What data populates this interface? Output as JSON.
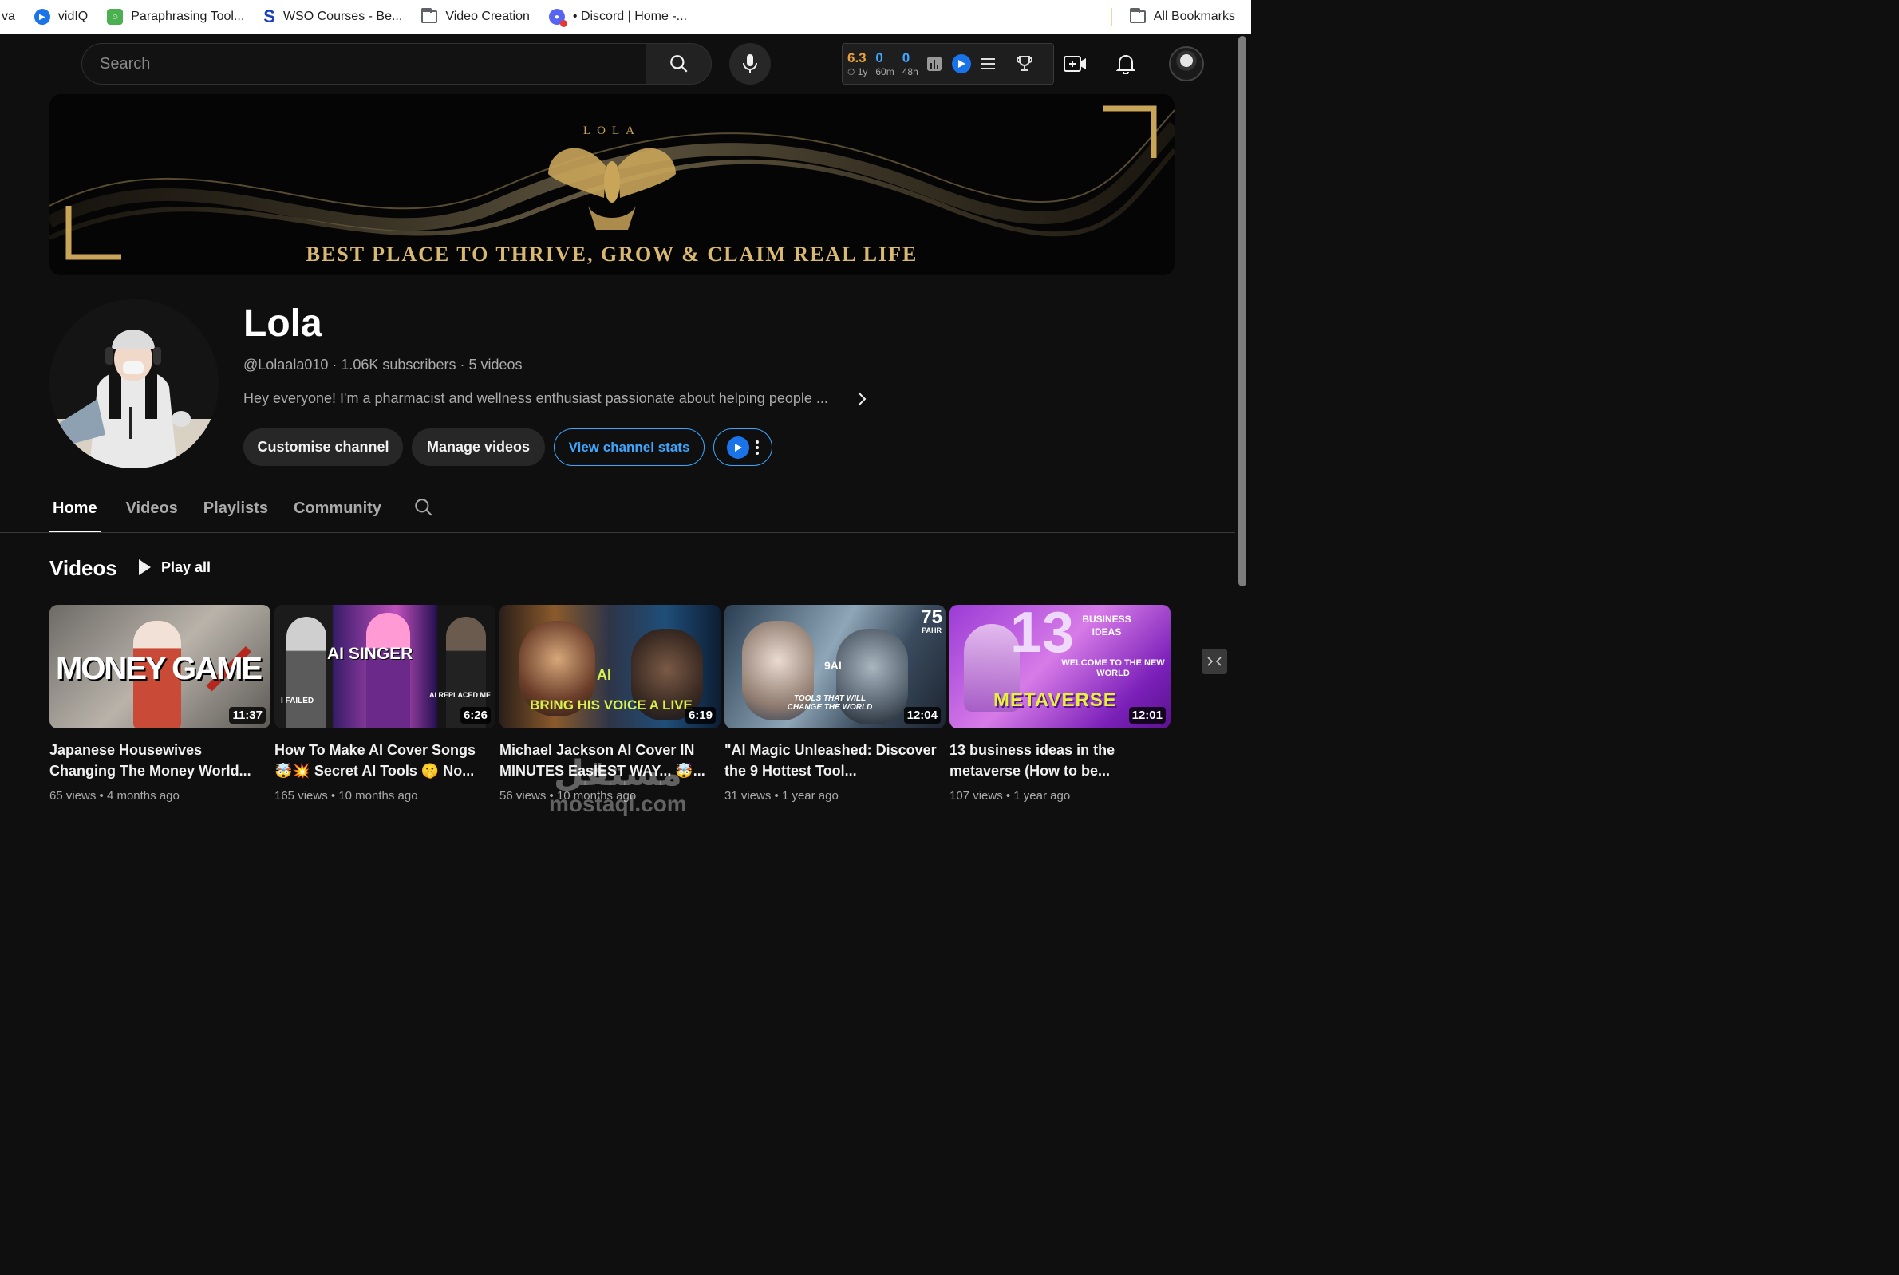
{
  "bookmarks": {
    "items": [
      {
        "label": "va",
        "icon": "partial-item"
      },
      {
        "label": "vidIQ",
        "icon": "vidiq-icon"
      },
      {
        "label": "Paraphrasing Tool...",
        "icon": "paraphrase-icon"
      },
      {
        "label": "WSO Courses - Be...",
        "icon": "wso-s-icon"
      },
      {
        "label": "Video Creation",
        "icon": "folder-icon"
      },
      {
        "label": "• Discord | Home -...",
        "icon": "discord-icon"
      }
    ],
    "all_bookmarks": "All Bookmarks"
  },
  "header": {
    "search_placeholder": "Search",
    "vidiq_stats": [
      {
        "value": "6.3",
        "label": "⏱ 1y",
        "color": "#e9a23b"
      },
      {
        "value": "0",
        "label": "60m",
        "color": "#3ea6ff"
      },
      {
        "value": "0",
        "label": "48h",
        "color": "#3ea6ff"
      }
    ]
  },
  "banner": {
    "logo_text": "LOLA",
    "tagline": "BEST PLACE TO THRIVE, GROW & CLAIM REAL LIFE"
  },
  "channel": {
    "name": "Lola",
    "handle": "@Lolaala010",
    "subscribers": "1.06K subscribers",
    "videos_count": "5 videos",
    "description": "Hey everyone! I'm a pharmacist and wellness enthusiast passionate about helping people ...",
    "buttons": {
      "customise": "Customise channel",
      "manage": "Manage videos",
      "stats": "View channel stats"
    }
  },
  "tabs": [
    "Home",
    "Videos",
    "Playlists",
    "Community"
  ],
  "videos_section": {
    "title": "Videos",
    "play_all": "Play all",
    "items": [
      {
        "title": "Japanese Housewives Changing The Money World...",
        "views": "65 views",
        "age": "4 months ago",
        "duration": "11:37",
        "thumb_text": "MONEY GAME"
      },
      {
        "title": "How To Make AI Cover Songs 🤯💥 Secret AI Tools 🤫 No...",
        "views": "165 views",
        "age": "10 months ago",
        "duration": "6:26",
        "thumb_text": "AI SINGER"
      },
      {
        "title": "Michael Jackson AI Cover IN MINUTES EasIEST WAY... 🤯...",
        "views": "56 views",
        "age": "10 months ago",
        "duration": "6:19",
        "thumb_text": "BRING HIS VOICE A LIVE"
      },
      {
        "title": "\"AI Magic Unleashed: Discover the 9 Hottest Tool...",
        "views": "31 views",
        "age": "1 year ago",
        "duration": "12:04",
        "thumb_text": "TOOLS THAT WILL CHANGE THE WORLD"
      },
      {
        "title": "13 business ideas in the metaverse (How to be...",
        "views": "107 views",
        "age": "1 year ago",
        "duration": "12:01",
        "thumb_text": "METAVERSE"
      }
    ]
  },
  "thumb_labels": {
    "v2_left": "I FAILED",
    "v2_right": "AI REPLACED ME",
    "v3_ai": "AI",
    "v4_badge": "75",
    "v4_badge_sub": "PAHR",
    "v4_9ai": "9AI",
    "v5_number": "13",
    "v5_business": "BUSINESS IDEAS",
    "v5_welcome": "WELCOME TO THE NEW WORLD"
  },
  "watermark": {
    "arabic": "مستقل",
    "latin": "mostaql.com"
  },
  "colors": {
    "accent_blue": "#3ea6ff",
    "gold": "#d9b870",
    "background": "#0f0f0f"
  }
}
